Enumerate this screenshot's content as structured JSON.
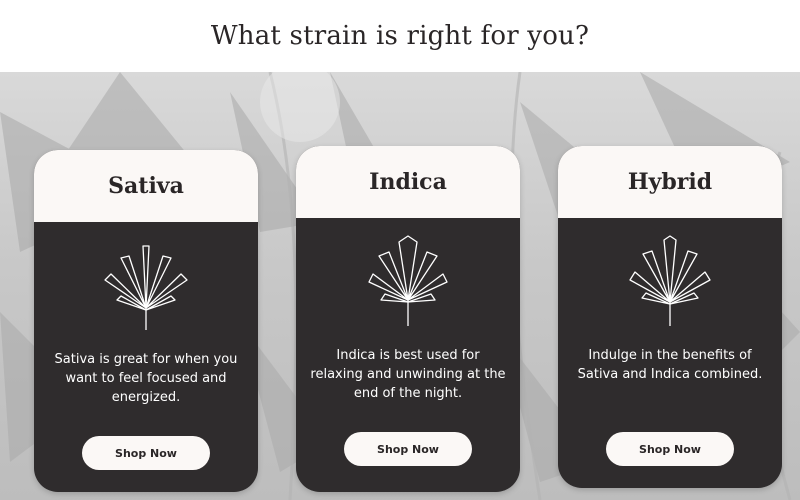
{
  "header": {
    "title": "What strain is right for you?"
  },
  "colors": {
    "card_dark": "#2f2c2d",
    "card_light": "#fbf8f6",
    "text_dark": "#2a2627"
  },
  "cards": [
    {
      "title": "Sativa",
      "icon": "cannabis-leaf-icon",
      "description": "Sativa is great for when you want to feel focused and energized.",
      "button_label": "Shop Now"
    },
    {
      "title": "Indica",
      "icon": "cannabis-leaf-icon",
      "description": "Indica is best used for relaxing and unwinding at the end of the night.",
      "button_label": "Shop Now"
    },
    {
      "title": "Hybrid",
      "icon": "cannabis-leaf-icon",
      "description": "Indulge in the benefits of Sativa and Indica combined.",
      "button_label": "Shop Now"
    }
  ]
}
